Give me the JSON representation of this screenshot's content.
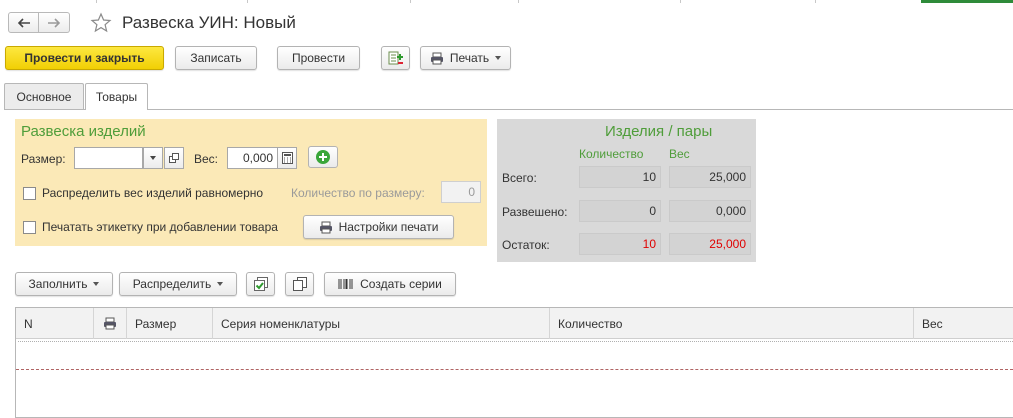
{
  "window": {
    "title": "Развеска УИН: Новый",
    "icons": {
      "back": "arrow-left-icon",
      "forward": "arrow-right-icon",
      "favorite": "star-icon"
    }
  },
  "toolbar": {
    "post_and_close": "Провести и закрыть",
    "save": "Записать",
    "post": "Провести",
    "print": "Печать",
    "icons": {
      "structure": "document-structure-icon",
      "print": "printer-icon"
    }
  },
  "tabs": [
    {
      "label": "Основное",
      "active": false
    },
    {
      "label": "Товары",
      "active": true
    }
  ],
  "weighing": {
    "title": "Развеска изделий",
    "size_label": "Размер:",
    "size_value": "",
    "weight_label": "Вес:",
    "weight_value": "0,000",
    "distribute_checkbox": {
      "label": "Распределить вес изделий равномерно",
      "checked": false
    },
    "qty_by_size_label": "Количество по размеру:",
    "qty_by_size_value": "0",
    "print_label_checkbox": {
      "label": "Печатать этикетку при добавлении товара",
      "checked": false
    },
    "print_settings": "Настройки печати"
  },
  "stats": {
    "title": "Изделия / пары",
    "col_qty": "Количество",
    "col_weight": "Вес",
    "rows": [
      {
        "label": "Всего:",
        "qty": "10",
        "weight": "25,000",
        "highlight": false
      },
      {
        "label": "Развешено:",
        "qty": "0",
        "weight": "0,000",
        "highlight": false
      },
      {
        "label": "Остаток:",
        "qty": "10",
        "weight": "25,000",
        "highlight": true
      }
    ]
  },
  "grid_toolbar": {
    "fill": "Заполнить",
    "distribute": "Распределить",
    "create_series": "Создать серии",
    "icons": {
      "check_all": "check-all-icon",
      "copy": "copy-icon",
      "barcode": "barcode-icon"
    }
  },
  "grid": {
    "columns": [
      "N",
      "",
      "Размер",
      "Серия номенклатуры",
      "Количество",
      "Вес"
    ],
    "rows": []
  },
  "colors": {
    "accent_green": "#4f9d3a",
    "primary_yellow": "#f5d50f",
    "panel_yellow": "#fbe9b7",
    "alert_red": "#e00000"
  }
}
